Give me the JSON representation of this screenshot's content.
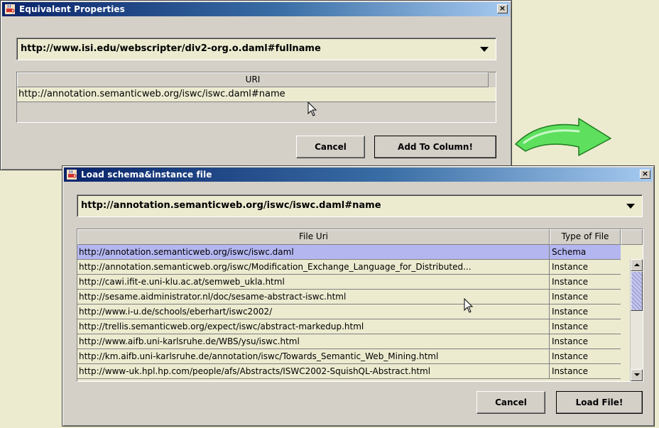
{
  "dialog1": {
    "title": "Equivalent Properties",
    "combo_value": "http://www.isi.edu/webscripter/div2-org.o.daml#fullname",
    "table_header": "URI",
    "rows": [
      "http://annotation.semanticweb.org/iswc/iswc.daml#name"
    ],
    "cancel_label": "Cancel",
    "add_label": "Add To Column!"
  },
  "dialog2": {
    "title": "Load schema&instance file",
    "combo_value": "http://annotation.semanticweb.org/iswc/iswc.daml#name",
    "columns": [
      "File Uri",
      "Type of File"
    ],
    "rows": [
      {
        "uri": "http://annotation.semanticweb.org/iswc/iswc.daml",
        "type": "Schema"
      },
      {
        "uri": "http://annotation.semanticweb.org/iswc/Modification_Exchange_Language_for_Distributed...",
        "type": "Instance"
      },
      {
        "uri": "http://cawi.ifit-e.uni-klu.ac.at/semweb_ukla.html",
        "type": "Instance"
      },
      {
        "uri": "http://sesame.aidministrator.nl/doc/sesame-abstract-iswc.html",
        "type": "Instance"
      },
      {
        "uri": "http://www.i-u.de/schools/eberhart/iswc2002/",
        "type": "Instance"
      },
      {
        "uri": "http://trellis.semanticweb.org/expect/iswc/abstract-markedup.html",
        "type": "Instance"
      },
      {
        "uri": "http://www.aifb.uni-karlsruhe.de/WBS/ysu/iswc.html",
        "type": "Instance"
      },
      {
        "uri": "http://km.aifb.uni-karlsruhe.de/annotation/iswc/Towards_Semantic_Web_Mining.html",
        "type": "Instance"
      },
      {
        "uri": "http://www-uk.hpl.hp.com/people/afs/Abstracts/ISWC2002-SquishQL-Abstract.html",
        "type": "Instance"
      }
    ],
    "cancel_label": "Cancel",
    "load_label": "Load File!"
  },
  "colors": {
    "selection": "#b4b6f0",
    "arrow_green": "#5ee05e",
    "titlebar_start": "#0a246a",
    "titlebar_end": "#a6caf0"
  },
  "icons": {
    "window_icon": "java-coffee-cup-icon",
    "arrow": "curved-arrow-icon"
  }
}
